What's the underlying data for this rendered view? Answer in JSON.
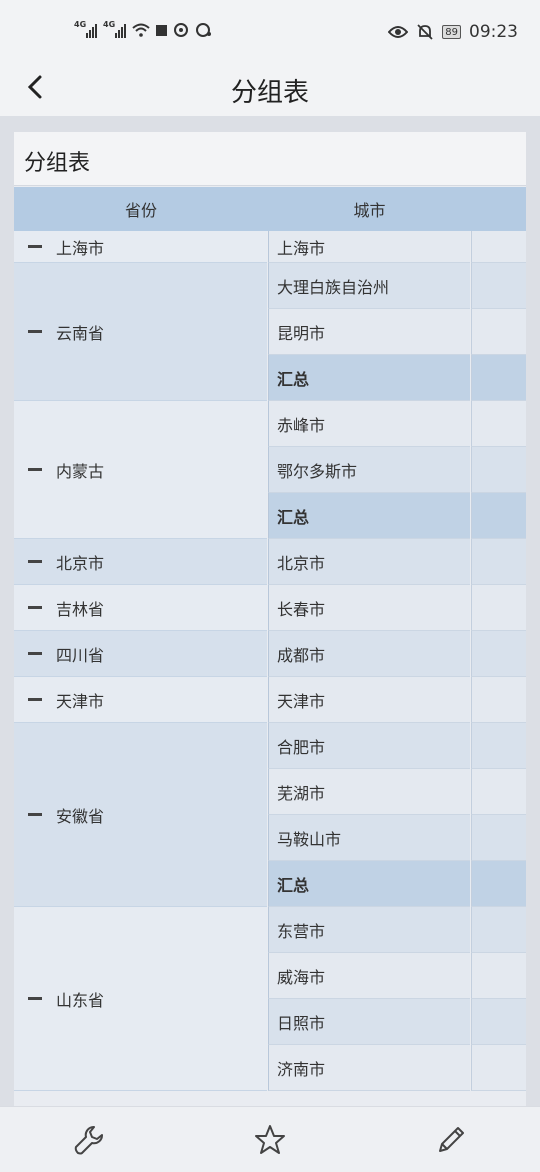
{
  "status_bar": {
    "signal_1_tag": "4G",
    "signal_2_tag": "4G",
    "battery": "89",
    "time": "09:23",
    "icons": [
      "signal-icon",
      "signal-icon",
      "wifi-icon",
      "square-icon",
      "app-icon",
      "chat-icon",
      "eye-icon",
      "bell-off-icon",
      "battery-icon"
    ]
  },
  "nav": {
    "title": "分组表",
    "back_icon": "back-arrow-icon"
  },
  "card": {
    "title": "分组表"
  },
  "table": {
    "headers": [
      "省份",
      "城市"
    ],
    "rows": [
      {
        "province": "上海市",
        "cities": [
          "上海市"
        ]
      },
      {
        "province": "云南省",
        "cities": [
          "大理白族自治州",
          "昆明市",
          "汇总"
        ]
      },
      {
        "province": "内蒙古",
        "cities": [
          "赤峰市",
          "鄂尔多斯市",
          "汇总"
        ]
      },
      {
        "province": "北京市",
        "cities": [
          "北京市"
        ]
      },
      {
        "province": "吉林省",
        "cities": [
          "长春市"
        ]
      },
      {
        "province": "四川省",
        "cities": [
          "成都市"
        ]
      },
      {
        "province": "天津市",
        "cities": [
          "天津市"
        ]
      },
      {
        "province": "安徽省",
        "cities": [
          "合肥市",
          "芜湖市",
          "马鞍山市",
          "汇总"
        ]
      },
      {
        "province": "山东省",
        "cities": [
          "东营市",
          "威海市",
          "日照市",
          "济南市"
        ]
      }
    ]
  },
  "bottom_bar": {
    "items": [
      {
        "icon": "wrench-icon"
      },
      {
        "icon": "star-icon"
      },
      {
        "icon": "pencil-icon"
      }
    ]
  }
}
